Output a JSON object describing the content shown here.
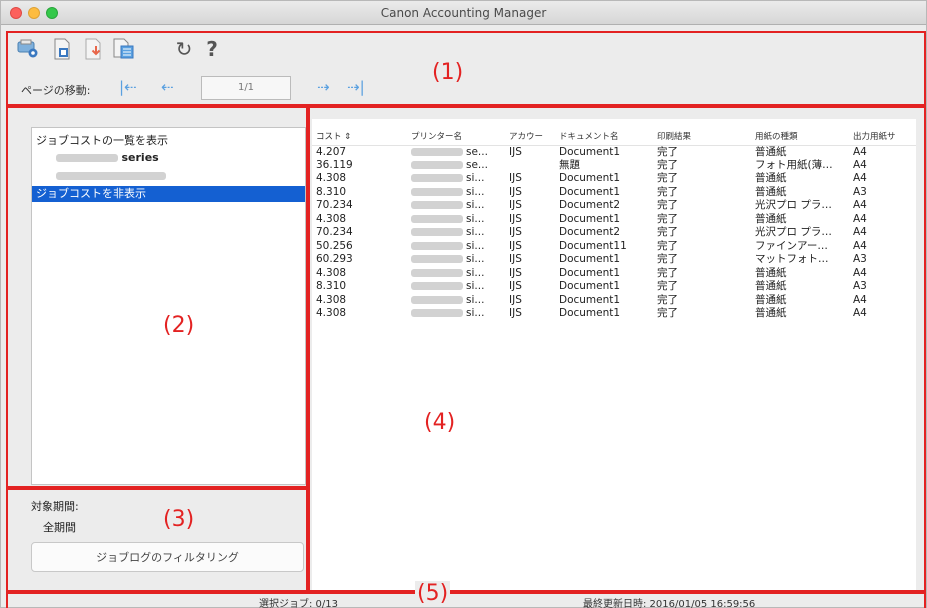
{
  "window": {
    "title": "Canon Accounting Manager"
  },
  "toolbar": {
    "icons": [
      "printer-settings-icon",
      "export-icon",
      "import-icon",
      "csv-icon",
      "refresh-icon",
      "help-icon"
    ],
    "help_glyph": "?",
    "refresh_glyph": "↻",
    "page_nav_label": "ページの移動:",
    "page_value": "1/1",
    "nav_first": "|⇠",
    "nav_prev": "⇠",
    "nav_next": "⇢",
    "nav_last": "⇢|"
  },
  "annotations": {
    "region1": "(1)",
    "region2": "(2)",
    "region3": "(3)",
    "region4": "(4)",
    "region5": "(5)",
    "color": "#e32222"
  },
  "sidebar": {
    "tree": [
      {
        "label": "ジョブコストの一覧を表示",
        "selected": false
      },
      {
        "label": "series",
        "selected": false
      },
      {
        "label": "",
        "selected": false
      },
      {
        "label": "ジョブコストを非表示",
        "selected": true
      }
    ],
    "period_label": "対象期間:",
    "period_value": "全期間",
    "filter_button": "ジョブログのフィルタリング",
    "selection_color": "#1460d2"
  },
  "table": {
    "columns": [
      "コスト ⇕",
      "プリンター名",
      "アカウー",
      "ドキュメント名",
      "印刷結果",
      "用紙の種類",
      "出力用紙サ"
    ],
    "rows": [
      [
        "4.207",
        "se...",
        "IJS",
        "Document1",
        "完了",
        "普通紙",
        "A4"
      ],
      [
        "36.119",
        "se...",
        "",
        "無題",
        "完了",
        "フォト用紙(薄…",
        "A4"
      ],
      [
        "4.308",
        "si...",
        "IJS",
        "Document1",
        "完了",
        "普通紙",
        "A4"
      ],
      [
        "8.310",
        "si...",
        "IJS",
        "Document1",
        "完了",
        "普通紙",
        "A3"
      ],
      [
        "70.234",
        "si...",
        "IJS",
        "Document2",
        "完了",
        "光沢プロ プラ…",
        "A4"
      ],
      [
        "4.308",
        "si...",
        "IJS",
        "Document1",
        "完了",
        "普通紙",
        "A4"
      ],
      [
        "70.234",
        "si...",
        "IJS",
        "Document2",
        "完了",
        "光沢プロ プラ…",
        "A4"
      ],
      [
        "50.256",
        "si...",
        "IJS",
        "Document11",
        "完了",
        "ファインアー…",
        "A4"
      ],
      [
        "60.293",
        "si...",
        "IJS",
        "Document1",
        "完了",
        "マットフォト…",
        "A3"
      ],
      [
        "4.308",
        "si...",
        "IJS",
        "Document1",
        "完了",
        "普通紙",
        "A4"
      ],
      [
        "8.310",
        "si...",
        "IJS",
        "Document1",
        "完了",
        "普通紙",
        "A3"
      ],
      [
        "4.308",
        "si...",
        "IJS",
        "Document1",
        "完了",
        "普通紙",
        "A4"
      ],
      [
        "4.308",
        "si...",
        "IJS",
        "Document1",
        "完了",
        "普通紙",
        "A4"
      ]
    ]
  },
  "status": {
    "selected_jobs": "選択ジョブ: 0/13",
    "last_updated": "最終更新日時: 2016/01/05 16:59:56"
  }
}
